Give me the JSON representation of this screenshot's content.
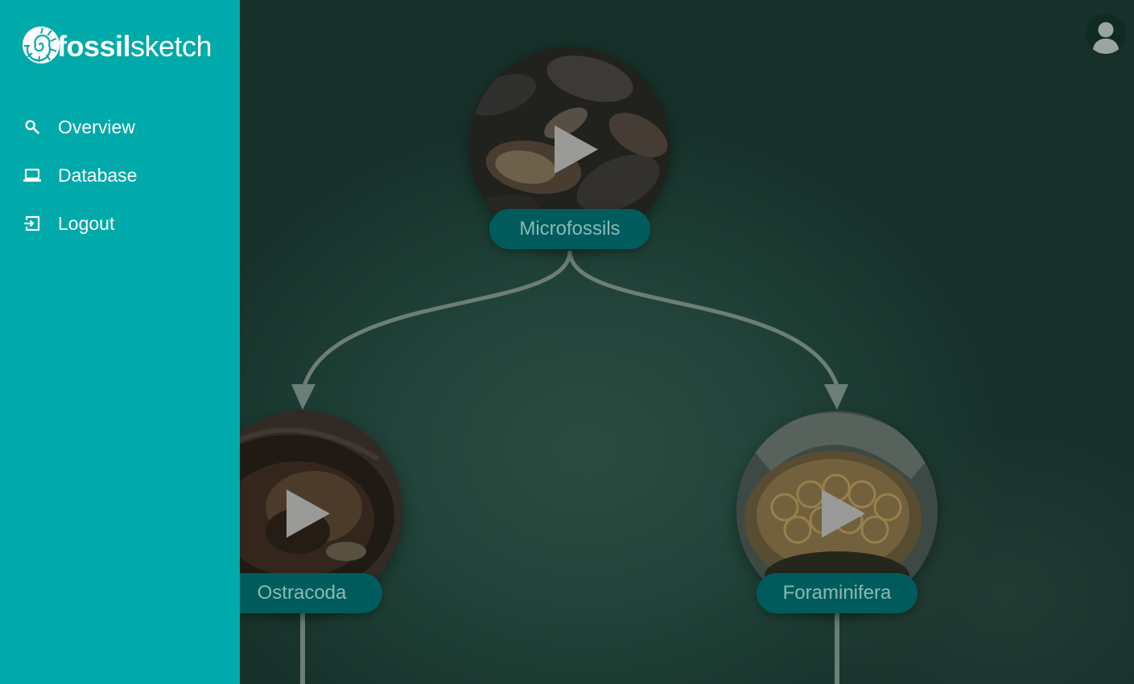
{
  "app": {
    "logo_bold": "fossil",
    "logo_light": "sketch"
  },
  "sidebar": {
    "items": [
      {
        "label": "Overview",
        "icon": "search-icon"
      },
      {
        "label": "Database",
        "icon": "laptop-icon"
      },
      {
        "label": "Logout",
        "icon": "logout-icon"
      }
    ]
  },
  "header": {
    "avatar_icon": "user-avatar-icon"
  },
  "tree": {
    "nodes": [
      {
        "label": "Microfossils",
        "icon": "play-icon"
      },
      {
        "label": "Ostracoda",
        "icon": "play-icon"
      },
      {
        "label": "Foraminifera",
        "icon": "play-icon"
      }
    ]
  },
  "colors": {
    "sidebar_bg": "#00aaaa",
    "main_bg": "#1f3f35",
    "label_pill_bg": "#005c5c",
    "label_text": "#8ab8b8",
    "connector": "#6d7d78"
  }
}
